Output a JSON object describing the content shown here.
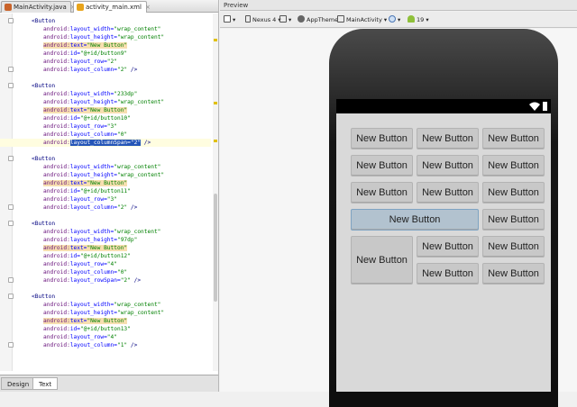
{
  "editor_tabs": [
    {
      "label": "MainActivity.java",
      "color": "#c9632a"
    },
    {
      "label": "activity_main.xml",
      "color": "#e8a41b"
    }
  ],
  "bottom_tabs": [
    "Design",
    "Text"
  ],
  "code_lines": [
    {
      "ind": 2,
      "parts": [
        [
          "tag",
          "<Button"
        ]
      ]
    },
    {
      "ind": 4,
      "parts": [
        [
          "ns",
          "android:"
        ],
        [
          "at",
          "layout_width="
        ],
        [
          "val",
          "\"wrap_content\""
        ]
      ]
    },
    {
      "ind": 4,
      "parts": [
        [
          "ns",
          "android:"
        ],
        [
          "at",
          "layout_height="
        ],
        [
          "val",
          "\"wrap_content\""
        ]
      ]
    },
    {
      "ind": 4,
      "parts": [
        [
          "ns hlbg",
          "android:"
        ],
        [
          "at hlbg",
          "text="
        ],
        [
          "val hlbg",
          "\"New Button\""
        ]
      ]
    },
    {
      "ind": 4,
      "parts": [
        [
          "ns",
          "android:"
        ],
        [
          "at",
          "id="
        ],
        [
          "val",
          "\"@+id/button9\""
        ]
      ]
    },
    {
      "ind": 4,
      "parts": [
        [
          "ns",
          "android:"
        ],
        [
          "at",
          "layout_row="
        ],
        [
          "val",
          "\"2\""
        ]
      ]
    },
    {
      "ind": 4,
      "parts": [
        [
          "ns",
          "android:"
        ],
        [
          "at",
          "layout_column="
        ],
        [
          "val",
          "\"2\""
        ],
        [
          "tag",
          " />"
        ]
      ]
    },
    {
      "ind": 0,
      "parts": []
    },
    {
      "ind": 2,
      "parts": [
        [
          "tag",
          "<Button"
        ]
      ]
    },
    {
      "ind": 4,
      "parts": [
        [
          "ns",
          "android:"
        ],
        [
          "at",
          "layout_width="
        ],
        [
          "val",
          "\"233dp\""
        ]
      ]
    },
    {
      "ind": 4,
      "parts": [
        [
          "ns",
          "android:"
        ],
        [
          "at",
          "layout_height="
        ],
        [
          "val",
          "\"wrap_content\""
        ]
      ]
    },
    {
      "ind": 4,
      "parts": [
        [
          "ns hlbg",
          "android:"
        ],
        [
          "at hlbg",
          "text="
        ],
        [
          "val hlbg",
          "\"New Button\""
        ]
      ]
    },
    {
      "ind": 4,
      "parts": [
        [
          "ns",
          "android:"
        ],
        [
          "at",
          "id="
        ],
        [
          "val",
          "\"@+id/button10\""
        ]
      ]
    },
    {
      "ind": 4,
      "parts": [
        [
          "ns",
          "android:"
        ],
        [
          "at",
          "layout_row="
        ],
        [
          "val",
          "\"3\""
        ]
      ]
    },
    {
      "ind": 4,
      "parts": [
        [
          "ns",
          "android:"
        ],
        [
          "at",
          "layout_column="
        ],
        [
          "val",
          "\"0\""
        ]
      ]
    },
    {
      "ind": 4,
      "cur": true,
      "parts": [
        [
          "ns",
          "android:"
        ],
        [
          "at hlsel",
          "layout_columnSpan="
        ],
        [
          "val hlsel",
          "\"2\""
        ],
        [
          "tag",
          " />"
        ]
      ]
    },
    {
      "ind": 0,
      "parts": []
    },
    {
      "ind": 2,
      "parts": [
        [
          "tag",
          "<Button"
        ]
      ]
    },
    {
      "ind": 4,
      "parts": [
        [
          "ns",
          "android:"
        ],
        [
          "at",
          "layout_width="
        ],
        [
          "val",
          "\"wrap_content\""
        ]
      ]
    },
    {
      "ind": 4,
      "parts": [
        [
          "ns",
          "android:"
        ],
        [
          "at",
          "layout_height="
        ],
        [
          "val",
          "\"wrap_content\""
        ]
      ]
    },
    {
      "ind": 4,
      "parts": [
        [
          "ns hlbg",
          "android:"
        ],
        [
          "at hlbg",
          "text="
        ],
        [
          "val hlbg",
          "\"New Button\""
        ]
      ]
    },
    {
      "ind": 4,
      "parts": [
        [
          "ns",
          "android:"
        ],
        [
          "at",
          "id="
        ],
        [
          "val",
          "\"@+id/button11\""
        ]
      ]
    },
    {
      "ind": 4,
      "parts": [
        [
          "ns",
          "android:"
        ],
        [
          "at",
          "layout_row="
        ],
        [
          "val",
          "\"3\""
        ]
      ]
    },
    {
      "ind": 4,
      "parts": [
        [
          "ns",
          "android:"
        ],
        [
          "at",
          "layout_column="
        ],
        [
          "val",
          "\"2\""
        ],
        [
          "tag",
          " />"
        ]
      ]
    },
    {
      "ind": 0,
      "parts": []
    },
    {
      "ind": 2,
      "parts": [
        [
          "tag",
          "<Button"
        ]
      ]
    },
    {
      "ind": 4,
      "parts": [
        [
          "ns",
          "android:"
        ],
        [
          "at",
          "layout_width="
        ],
        [
          "val",
          "\"wrap_content\""
        ]
      ]
    },
    {
      "ind": 4,
      "parts": [
        [
          "ns",
          "android:"
        ],
        [
          "at",
          "layout_height="
        ],
        [
          "val",
          "\"97dp\""
        ]
      ]
    },
    {
      "ind": 4,
      "parts": [
        [
          "ns hlbg",
          "android:"
        ],
        [
          "at hlbg",
          "text="
        ],
        [
          "val hlbg",
          "\"New Button\""
        ]
      ]
    },
    {
      "ind": 4,
      "parts": [
        [
          "ns",
          "android:"
        ],
        [
          "at",
          "id="
        ],
        [
          "val",
          "\"@+id/button12\""
        ]
      ]
    },
    {
      "ind": 4,
      "parts": [
        [
          "ns",
          "android:"
        ],
        [
          "at",
          "layout_row="
        ],
        [
          "val",
          "\"4\""
        ]
      ]
    },
    {
      "ind": 4,
      "parts": [
        [
          "ns",
          "android:"
        ],
        [
          "at",
          "layout_column="
        ],
        [
          "val",
          "\"0\""
        ]
      ]
    },
    {
      "ind": 4,
      "parts": [
        [
          "ns",
          "android:"
        ],
        [
          "at",
          "layout_rowSpan="
        ],
        [
          "val",
          "\"2\""
        ],
        [
          "tag",
          " />"
        ]
      ]
    },
    {
      "ind": 0,
      "parts": []
    },
    {
      "ind": 2,
      "parts": [
        [
          "tag",
          "<Button"
        ]
      ]
    },
    {
      "ind": 4,
      "parts": [
        [
          "ns",
          "android:"
        ],
        [
          "at",
          "layout_width="
        ],
        [
          "val",
          "\"wrap_content\""
        ]
      ]
    },
    {
      "ind": 4,
      "parts": [
        [
          "ns",
          "android:"
        ],
        [
          "at",
          "layout_height="
        ],
        [
          "val",
          "\"wrap_content\""
        ]
      ]
    },
    {
      "ind": 4,
      "parts": [
        [
          "ns hlbg",
          "android:"
        ],
        [
          "at hlbg",
          "text="
        ],
        [
          "val hlbg",
          "\"New Button\""
        ]
      ]
    },
    {
      "ind": 4,
      "parts": [
        [
          "ns",
          "android:"
        ],
        [
          "at",
          "id="
        ],
        [
          "val",
          "\"@+id/button13\""
        ]
      ]
    },
    {
      "ind": 4,
      "parts": [
        [
          "ns",
          "android:"
        ],
        [
          "at",
          "layout_row="
        ],
        [
          "val",
          "\"4\""
        ]
      ]
    },
    {
      "ind": 4,
      "parts": [
        [
          "ns",
          "android:"
        ],
        [
          "at",
          "layout_column="
        ],
        [
          "val",
          "\"1\""
        ],
        [
          "tag",
          " />"
        ]
      ]
    },
    {
      "ind": 0,
      "parts": []
    }
  ],
  "preview": {
    "title": "Preview",
    "toolbar": {
      "device": "Nexus 4",
      "theme": "AppTheme",
      "activity": "MainActivity",
      "api": "19"
    },
    "grid_buttons": [
      {
        "label": "New Button"
      },
      {
        "label": "New Button"
      },
      {
        "label": "New Button"
      },
      {
        "label": "New Button"
      },
      {
        "label": "New Button"
      },
      {
        "label": "New Button"
      },
      {
        "label": "New Button"
      },
      {
        "label": "New Button"
      },
      {
        "label": "New Button"
      },
      {
        "label": "New Button",
        "selected": true
      },
      {
        "label": "New Button"
      },
      {
        "label": "New Button"
      },
      {
        "label": "New Button"
      },
      {
        "label": "New Button"
      },
      {
        "label": "New Button"
      },
      {
        "label": "New Button"
      }
    ]
  }
}
